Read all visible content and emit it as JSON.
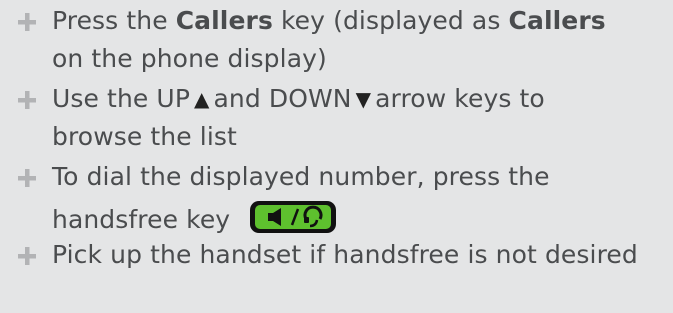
{
  "instructions": [
    {
      "line1": {
        "pre": "Press the ",
        "bold1": "Callers",
        "mid": " key (displayed as ",
        "bold2": "Callers"
      },
      "line2": "on the phone display)"
    },
    {
      "line1": {
        "pre": "Use the UP",
        "up_arrow": "▲",
        "mid": "and DOWN",
        "down_arrow": "▼",
        "post": "arrow keys to"
      },
      "line2": "browse the list"
    },
    {
      "line1": "To dial the displayed number, press the",
      "line2": "handsfree key",
      "key_icon": "speaker-handset-key-icon"
    },
    {
      "line1": "Pick up the handset if handsfree is not desired"
    }
  ],
  "colors": {
    "background": "#e4e5e6",
    "text": "#4a4c4e",
    "bullet": "#b2b3b5",
    "key_green": "#5ec02e",
    "key_frame": "#111111"
  }
}
